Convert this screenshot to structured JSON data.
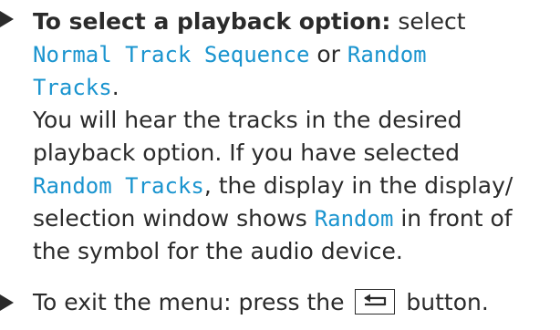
{
  "step1": {
    "bold_label": "To select a playback option",
    "colon": ":",
    "select_word": "select",
    "option_normal": "Normal Track Sequence",
    "or_word": "or",
    "option_random_line1": "Random",
    "option_random_line2": "Tracks",
    "period": ".",
    "result_line1": "You will hear the tracks in the desired",
    "result_line2": "playback option. If you have selected",
    "random_tracks": "Random Tracks",
    "result_line3_tail": ", the display in the display/",
    "result_line4_head": "selection window shows",
    "random_word": "Random",
    "result_line4_tail": "in front of",
    "result_line5": "the symbol for the audio device."
  },
  "step2": {
    "text_before": "To exit the menu: press the",
    "back_key_icon": "back-arrow-icon",
    "text_after": "button."
  },
  "colors": {
    "text": "#2b2b2b",
    "display_text": "#1a94cf"
  }
}
